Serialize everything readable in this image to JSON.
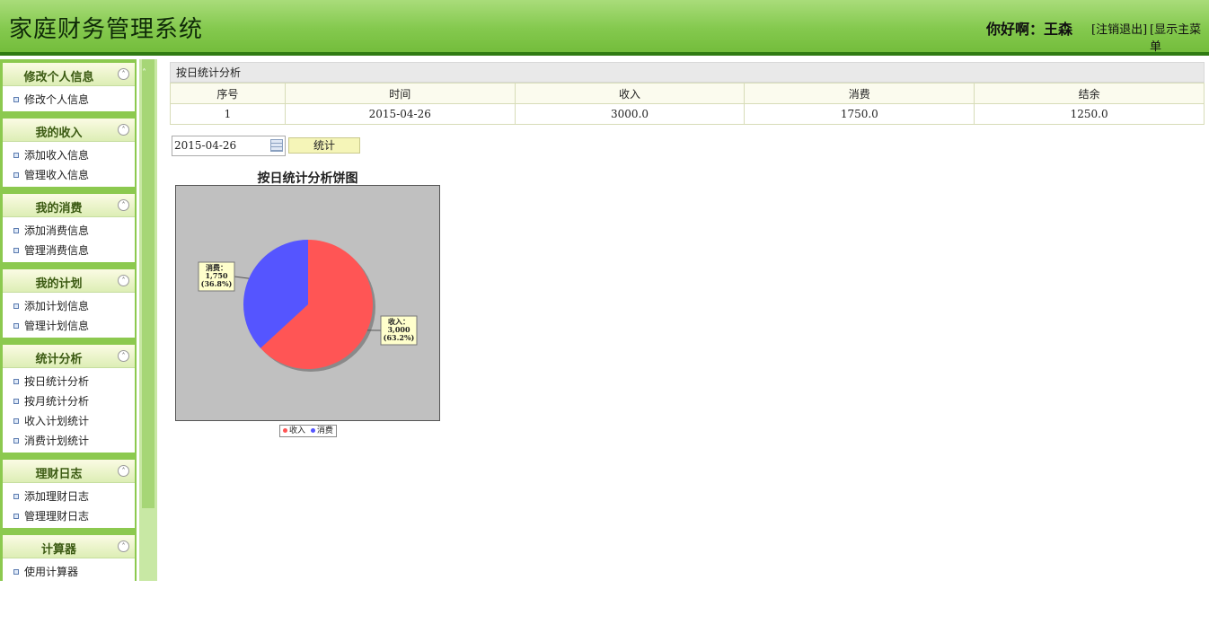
{
  "header": {
    "title": "家庭财务管理系统",
    "greeting": "你好啊：王森",
    "logout": "[注销退出]",
    "show_menu": "[显示主菜单"
  },
  "sidebar": {
    "groups": [
      {
        "title": "修改个人信息",
        "items": [
          "修改个人信息"
        ]
      },
      {
        "title": "我的收入",
        "items": [
          "添加收入信息",
          "管理收入信息"
        ]
      },
      {
        "title": "我的消费",
        "items": [
          "添加消费信息",
          "管理消费信息"
        ]
      },
      {
        "title": "我的计划",
        "items": [
          "添加计划信息",
          "管理计划信息"
        ]
      },
      {
        "title": "统计分析",
        "items": [
          "按日统计分析",
          "按月统计分析",
          "收入计划统计",
          "消费计划统计"
        ]
      },
      {
        "title": "理财日志",
        "items": [
          "添加理财日志",
          "管理理财日志"
        ]
      },
      {
        "title": "计算器",
        "items": [
          "使用计算器"
        ]
      }
    ]
  },
  "main": {
    "panel_title": "按日统计分析",
    "table": {
      "headers": [
        "序号",
        "时间",
        "收入",
        "消费",
        "结余"
      ],
      "rows": [
        [
          "1",
          "2015-04-26",
          "3000.0",
          "1750.0",
          "1250.0"
        ]
      ]
    },
    "date_value": "2015-04-26",
    "stat_button": "统计"
  },
  "colors": {
    "income": "#ff5555",
    "expense": "#5555ff",
    "header": "#84c94e"
  },
  "chart_data": {
    "type": "pie",
    "title": "按日统计分析饼图",
    "categories": [
      "收入",
      "消费"
    ],
    "values": [
      3000,
      1750
    ],
    "labels": [
      {
        "name": "收入：",
        "value": "3,000",
        "pct": "(63.2%)"
      },
      {
        "name": "消费：",
        "value": "1,750",
        "pct": "(36.8%)"
      }
    ],
    "legend": [
      "收入",
      "消费"
    ],
    "legend_position": "bottom"
  }
}
